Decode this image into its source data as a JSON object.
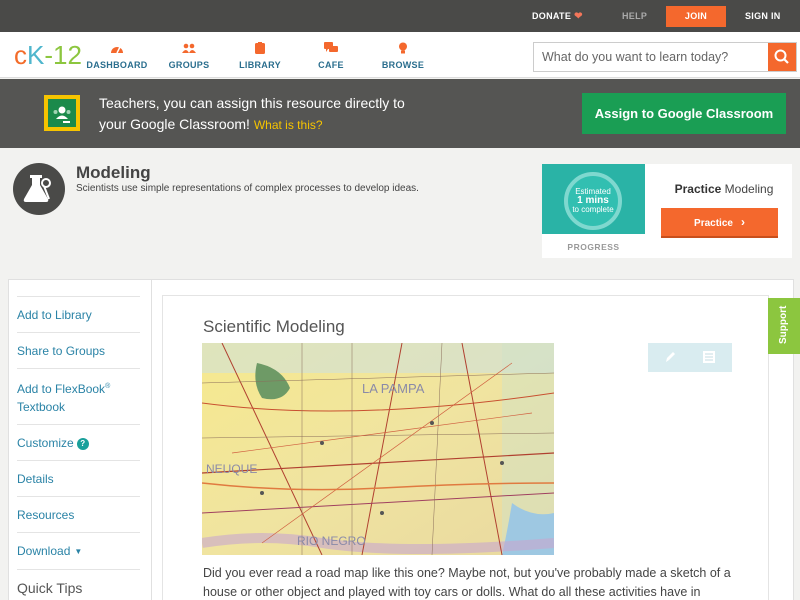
{
  "topbar": {
    "donate": "DONATE",
    "help": "HELP",
    "join": "JOIN",
    "signin": "SIGN IN"
  },
  "nav": {
    "logo": {
      "c": "c",
      "k": "K",
      "num": "-12"
    },
    "items": [
      {
        "label": "DASHBOARD",
        "icon": "dashboard-icon"
      },
      {
        "label": "GROUPS",
        "icon": "groups-icon"
      },
      {
        "label": "LIBRARY",
        "icon": "library-icon"
      },
      {
        "label": "CAFE",
        "icon": "cafe-icon"
      },
      {
        "label": "BROWSE",
        "icon": "browse-icon"
      }
    ],
    "search_placeholder": "What do you want to learn today?"
  },
  "banner": {
    "line1": "Teachers, you can assign this resource directly to",
    "line2": "your Google Classroom!",
    "whatis": "What is this?",
    "assign_label": "Assign to Google Classroom"
  },
  "concept": {
    "title": "Modeling",
    "description": "Scientists use simple representations of complex processes to develop ideas."
  },
  "practice": {
    "estimated": "Estimated",
    "mins": "1 mins",
    "to_complete": "to complete",
    "progress_label": "PROGRESS",
    "title_bold": "Practice",
    "title_rest": "Modeling",
    "button_label": "Practice"
  },
  "sidebar": {
    "add_library": "Add to Library",
    "share_groups": "Share to Groups",
    "add_flexbook_1": "Add to FlexBook",
    "add_flexbook_sup": "®",
    "add_flexbook_2": "Textbook",
    "customize": "Customize",
    "details": "Details",
    "resources": "Resources",
    "download": "Download",
    "quick_tips": "Quick Tips"
  },
  "article": {
    "title": "Scientific Modeling",
    "map_labels": {
      "pampa": "LA PAMPA",
      "rio": "RIO NEGRO",
      "neuquen": "NEUQUE"
    },
    "text": "Did you ever read a road map like this one? Maybe not, but you've probably made a sketch of a house or other object and played with toy cars or dolls. What do all these activities have in"
  },
  "support": "Support",
  "colors": {
    "accent_orange": "#f4682d",
    "google_green": "#1a9e54",
    "link_blue": "#2a83a6",
    "ck12_green": "#8cc63f"
  }
}
